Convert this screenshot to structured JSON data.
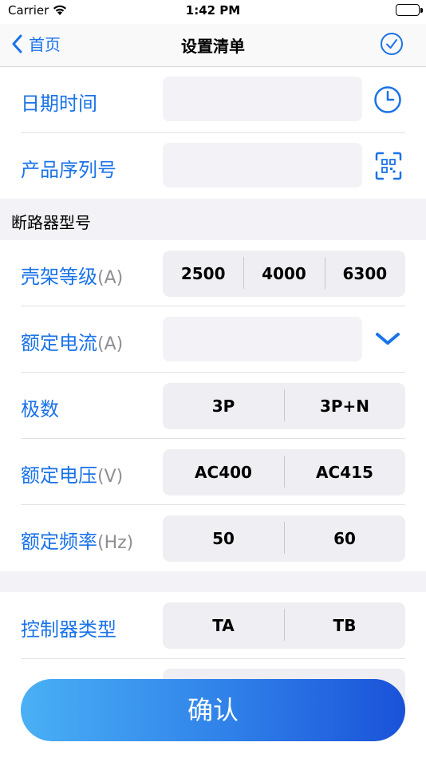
{
  "status_bar": {
    "carrier": "Carrier",
    "time": "1:42 PM"
  },
  "nav": {
    "back_label": "首页",
    "title": "设置清单"
  },
  "rows_top": [
    {
      "label": "日期时间",
      "value": "",
      "icon": "clock-icon"
    },
    {
      "label": "产品序列号",
      "value": "",
      "icon": "qr-scan-icon"
    }
  ],
  "section_breaker": {
    "title": "断路器型号"
  },
  "frame_grade": {
    "label": "壳架等级",
    "unit": "(A)",
    "options": [
      "2500",
      "4000",
      "6300"
    ]
  },
  "rated_current": {
    "label": "额定电流",
    "unit": "(A)",
    "value": "",
    "icon": "chevron-down-icon"
  },
  "poles": {
    "label": "极数",
    "options": [
      "3P",
      "3P+N"
    ]
  },
  "rated_voltage": {
    "label": "额定电压",
    "unit": "(V)",
    "options": [
      "AC400",
      "AC415"
    ]
  },
  "rated_frequency": {
    "label": "额定频率",
    "unit": "(Hz)",
    "options": [
      "50",
      "60"
    ]
  },
  "controller_type": {
    "label": "控制器类型",
    "options": [
      "TA",
      "TB"
    ]
  },
  "confirm_button": {
    "label": "确认"
  },
  "colors": {
    "accent": "#1a73e8",
    "field_bg": "#f2f2f7",
    "section_bg": "#f2f2f7"
  }
}
